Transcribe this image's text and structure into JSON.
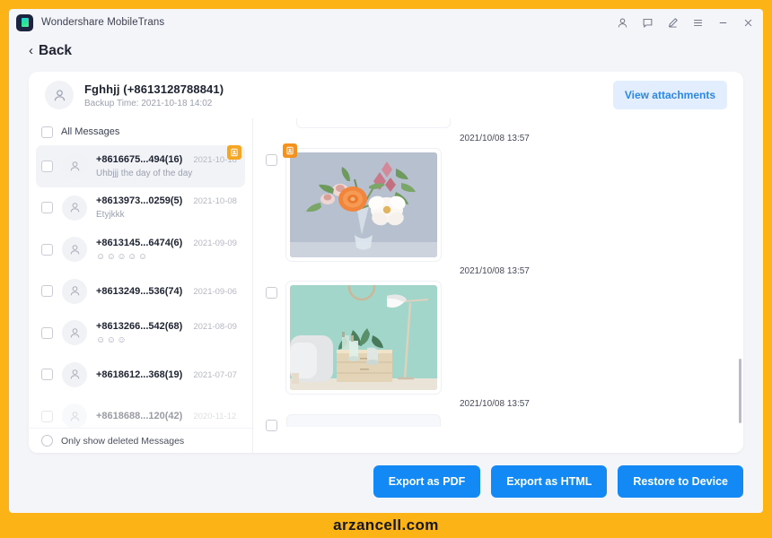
{
  "window": {
    "app_title": "Wondershare MobileTrans",
    "logo_name": "mobiletrans-logo",
    "controls": [
      {
        "name": "account-icon",
        "label": "account"
      },
      {
        "name": "feedback-icon",
        "label": "feedback"
      },
      {
        "name": "edit-icon",
        "label": "edit"
      },
      {
        "name": "menu-icon",
        "label": "menu"
      },
      {
        "name": "minimize-icon",
        "label": "minimize"
      },
      {
        "name": "close-icon",
        "label": "close"
      }
    ]
  },
  "nav": {
    "back_label": "Back",
    "back_chevron": "‹"
  },
  "contact": {
    "name": "Fghhjj (+8613128788841)",
    "backup_time": "Backup Time: 2021-10-18 14:02",
    "view_attachments_label": "View attachments"
  },
  "list": {
    "all_messages_label": "All Messages",
    "only_deleted_label": "Only show deleted Messages",
    "items": [
      {
        "number": "+8616675...494(16)",
        "date": "2021-10-18",
        "preview": "Uhbjjj the day of the day",
        "selected": true,
        "has_attachment": true
      },
      {
        "number": "+8613973...0259(5)",
        "date": "2021-10-08",
        "preview": "Etyjkkk",
        "selected": false,
        "has_attachment": false
      },
      {
        "number": "+8613145...6474(6)",
        "date": "2021-09-09",
        "preview": "☺☺☺☺☺",
        "selected": false,
        "has_attachment": false
      },
      {
        "number": "+8613249...536(74)",
        "date": "2021-09-06",
        "preview": "",
        "selected": false,
        "has_attachment": false
      },
      {
        "number": "+8613266...542(68)",
        "date": "2021-08-09",
        "preview": "☺☺☺",
        "selected": false,
        "has_attachment": false
      },
      {
        "number": "+8618612...368(19)",
        "date": "2021-07-07",
        "preview": "",
        "selected": false,
        "has_attachment": false
      },
      {
        "number": "+8618688...120(42)",
        "date": "2020-11-12",
        "preview": "",
        "selected": false,
        "has_attachment": false
      }
    ]
  },
  "chat": {
    "messages": [
      {
        "time": "2021/10/08 13:57",
        "type": "image",
        "art": "flowers",
        "has_badge": true
      },
      {
        "time": "2021/10/08 13:57",
        "type": "image",
        "art": "room",
        "has_badge": false
      },
      {
        "time": "2021/10/08 13:57",
        "type": "image-partial",
        "art": "",
        "has_badge": false
      }
    ]
  },
  "actions": {
    "export_pdf": "Export as PDF",
    "export_html": "Export as HTML",
    "restore_device": "Restore to Device"
  },
  "watermark": {
    "text": "arzancell.com"
  },
  "colors": {
    "accent_blue": "#1289f5",
    "light_blue": "#e2eefd",
    "badge_orange": "#f5a623",
    "frame_yellow": "#fcb316"
  }
}
